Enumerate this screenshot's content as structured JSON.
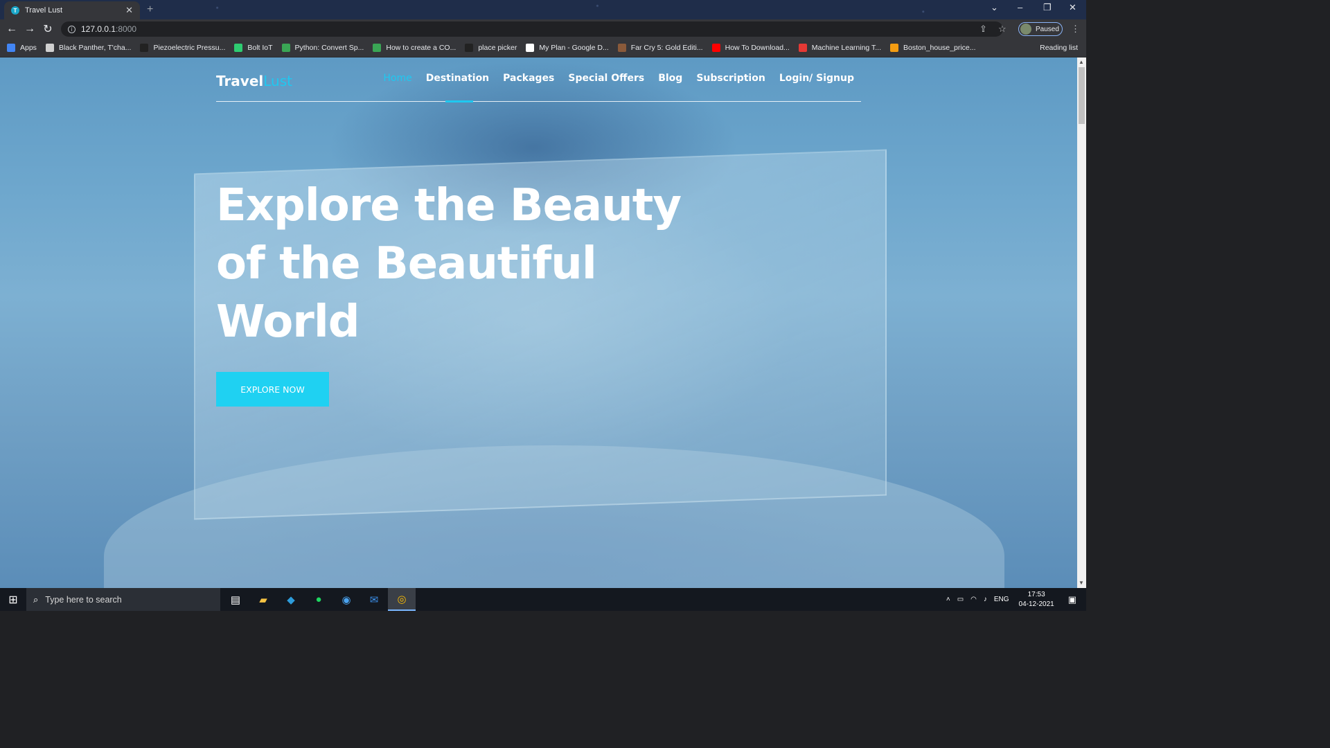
{
  "browser": {
    "tab_title": "Travel Lust",
    "tab_favicon_letter": "T",
    "tab_close": "✕",
    "new_tab": "+",
    "url_host": "127.0.0.1",
    "url_port": ":8000",
    "profile_status": "Paused",
    "reading_list": "Reading list",
    "bookmarks": [
      {
        "label": "Apps",
        "color": "#4285f4"
      },
      {
        "label": "Black Panther, T'cha...",
        "color": "#d0d0d0"
      },
      {
        "label": "Piezoelectric Pressu...",
        "color": "#222222"
      },
      {
        "label": "Bolt IoT",
        "color": "#2ecc71"
      },
      {
        "label": "Python: Convert Sp...",
        "color": "#3aa655"
      },
      {
        "label": "How to create a CO...",
        "color": "#3aa655"
      },
      {
        "label": "place picker",
        "color": "#222222"
      },
      {
        "label": "My Plan - Google D...",
        "color": "#ffffff"
      },
      {
        "label": "Far Cry 5: Gold Editi...",
        "color": "#8a5a3a"
      },
      {
        "label": "How To Download...",
        "color": "#ff0000"
      },
      {
        "label": "Machine Learning T...",
        "color": "#e53935"
      },
      {
        "label": "Boston_house_price...",
        "color": "#f39c12"
      }
    ]
  },
  "site": {
    "logo_main": "Travel",
    "logo_accent": "Lust",
    "nav": [
      "Home",
      "Destination",
      "Packages",
      "Special Offers",
      "Blog",
      "Subscription",
      "Login/ Signup"
    ],
    "active_nav": "Home",
    "hero_line1": "Explore the Beauty",
    "hero_line2": "of the Beautiful",
    "hero_line3": "World",
    "cta_label": "EXPLORE NOW",
    "accent_color": "#1fc8f0",
    "button_color": "#1fd1f2"
  },
  "taskbar": {
    "search_placeholder": "Type here to search",
    "language": "ENG",
    "time": "17:53",
    "date": "04-12-2021"
  }
}
